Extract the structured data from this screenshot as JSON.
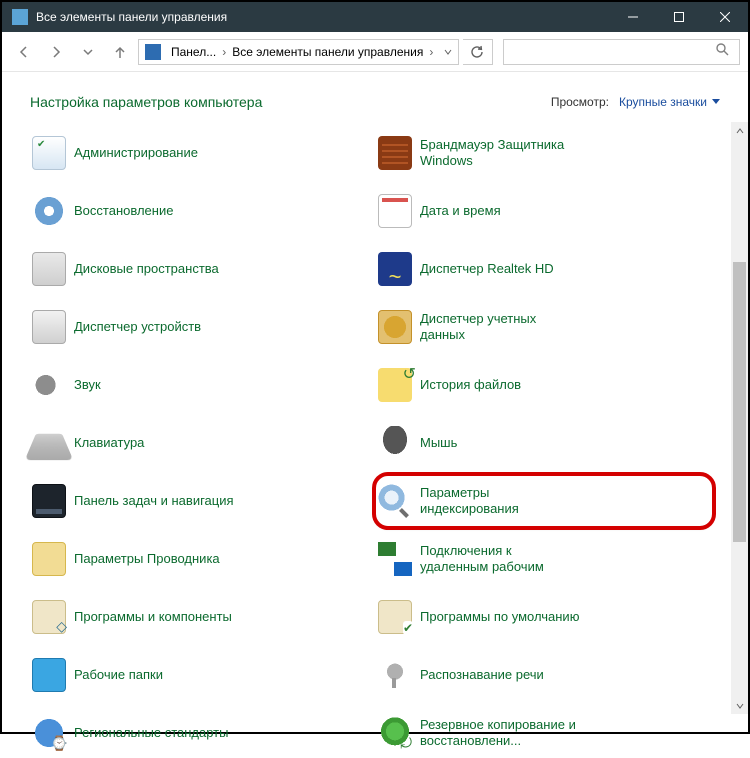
{
  "window": {
    "title": "Все элементы панели управления"
  },
  "breadcrumb": {
    "root": "Панел...",
    "current": "Все элементы панели управления"
  },
  "search": {
    "placeholder": ""
  },
  "header": {
    "title": "Настройка параметров компьютера",
    "view_label": "Просмотр:",
    "view_value": "Крупные значки"
  },
  "items": {
    "col1": [
      {
        "label": "Администрирование",
        "icon": "admin",
        "name": "item-administration"
      },
      {
        "label": "Восстановление",
        "icon": "recovery",
        "name": "item-recovery"
      },
      {
        "label": "Дисковые пространства",
        "icon": "disks",
        "name": "item-storage-spaces"
      },
      {
        "label": "Диспетчер устройств",
        "icon": "device",
        "name": "item-device-manager"
      },
      {
        "label": "Звук",
        "icon": "sound",
        "name": "item-sound"
      },
      {
        "label": "Клавиатура",
        "icon": "keyboard",
        "name": "item-keyboard"
      },
      {
        "label": "Панель задач и навигация",
        "icon": "taskbar",
        "name": "item-taskbar-navigation"
      },
      {
        "label": "Параметры Проводника",
        "icon": "explorer",
        "name": "item-explorer-options"
      },
      {
        "label": "Программы и компоненты",
        "icon": "programs",
        "name": "item-programs-and-features"
      },
      {
        "label": "Рабочие папки",
        "icon": "workfolders",
        "name": "item-work-folders"
      },
      {
        "label": "Региональные стандарты",
        "icon": "regional",
        "name": "item-region"
      }
    ],
    "col2": [
      {
        "label": "Брандмауэр Защитника Windows",
        "icon": "firewall",
        "name": "item-defender-firewall"
      },
      {
        "label": "Дата и время",
        "icon": "datetime",
        "name": "item-date-time"
      },
      {
        "label": "Диспетчер Realtek HD",
        "icon": "realtek",
        "name": "item-realtek-hd"
      },
      {
        "label": "Диспетчер учетных данных",
        "icon": "creds",
        "name": "item-credential-manager"
      },
      {
        "label": "История файлов",
        "icon": "history",
        "name": "item-file-history"
      },
      {
        "label": "Мышь",
        "icon": "mouse",
        "name": "item-mouse"
      },
      {
        "label": "Параметры индексирования",
        "icon": "indexing",
        "name": "item-indexing-options",
        "highlight": true
      },
      {
        "label": "Подключения к удаленным рабочим",
        "icon": "rdp",
        "name": "item-remoteapp"
      },
      {
        "label": "Программы по умолчанию",
        "icon": "defaults",
        "name": "item-default-programs"
      },
      {
        "label": "Распознавание речи",
        "icon": "speech",
        "name": "item-speech-recognition"
      },
      {
        "label": "Резервное копирование и восстановлени...",
        "icon": "backup",
        "name": "item-backup-restore"
      }
    ]
  }
}
